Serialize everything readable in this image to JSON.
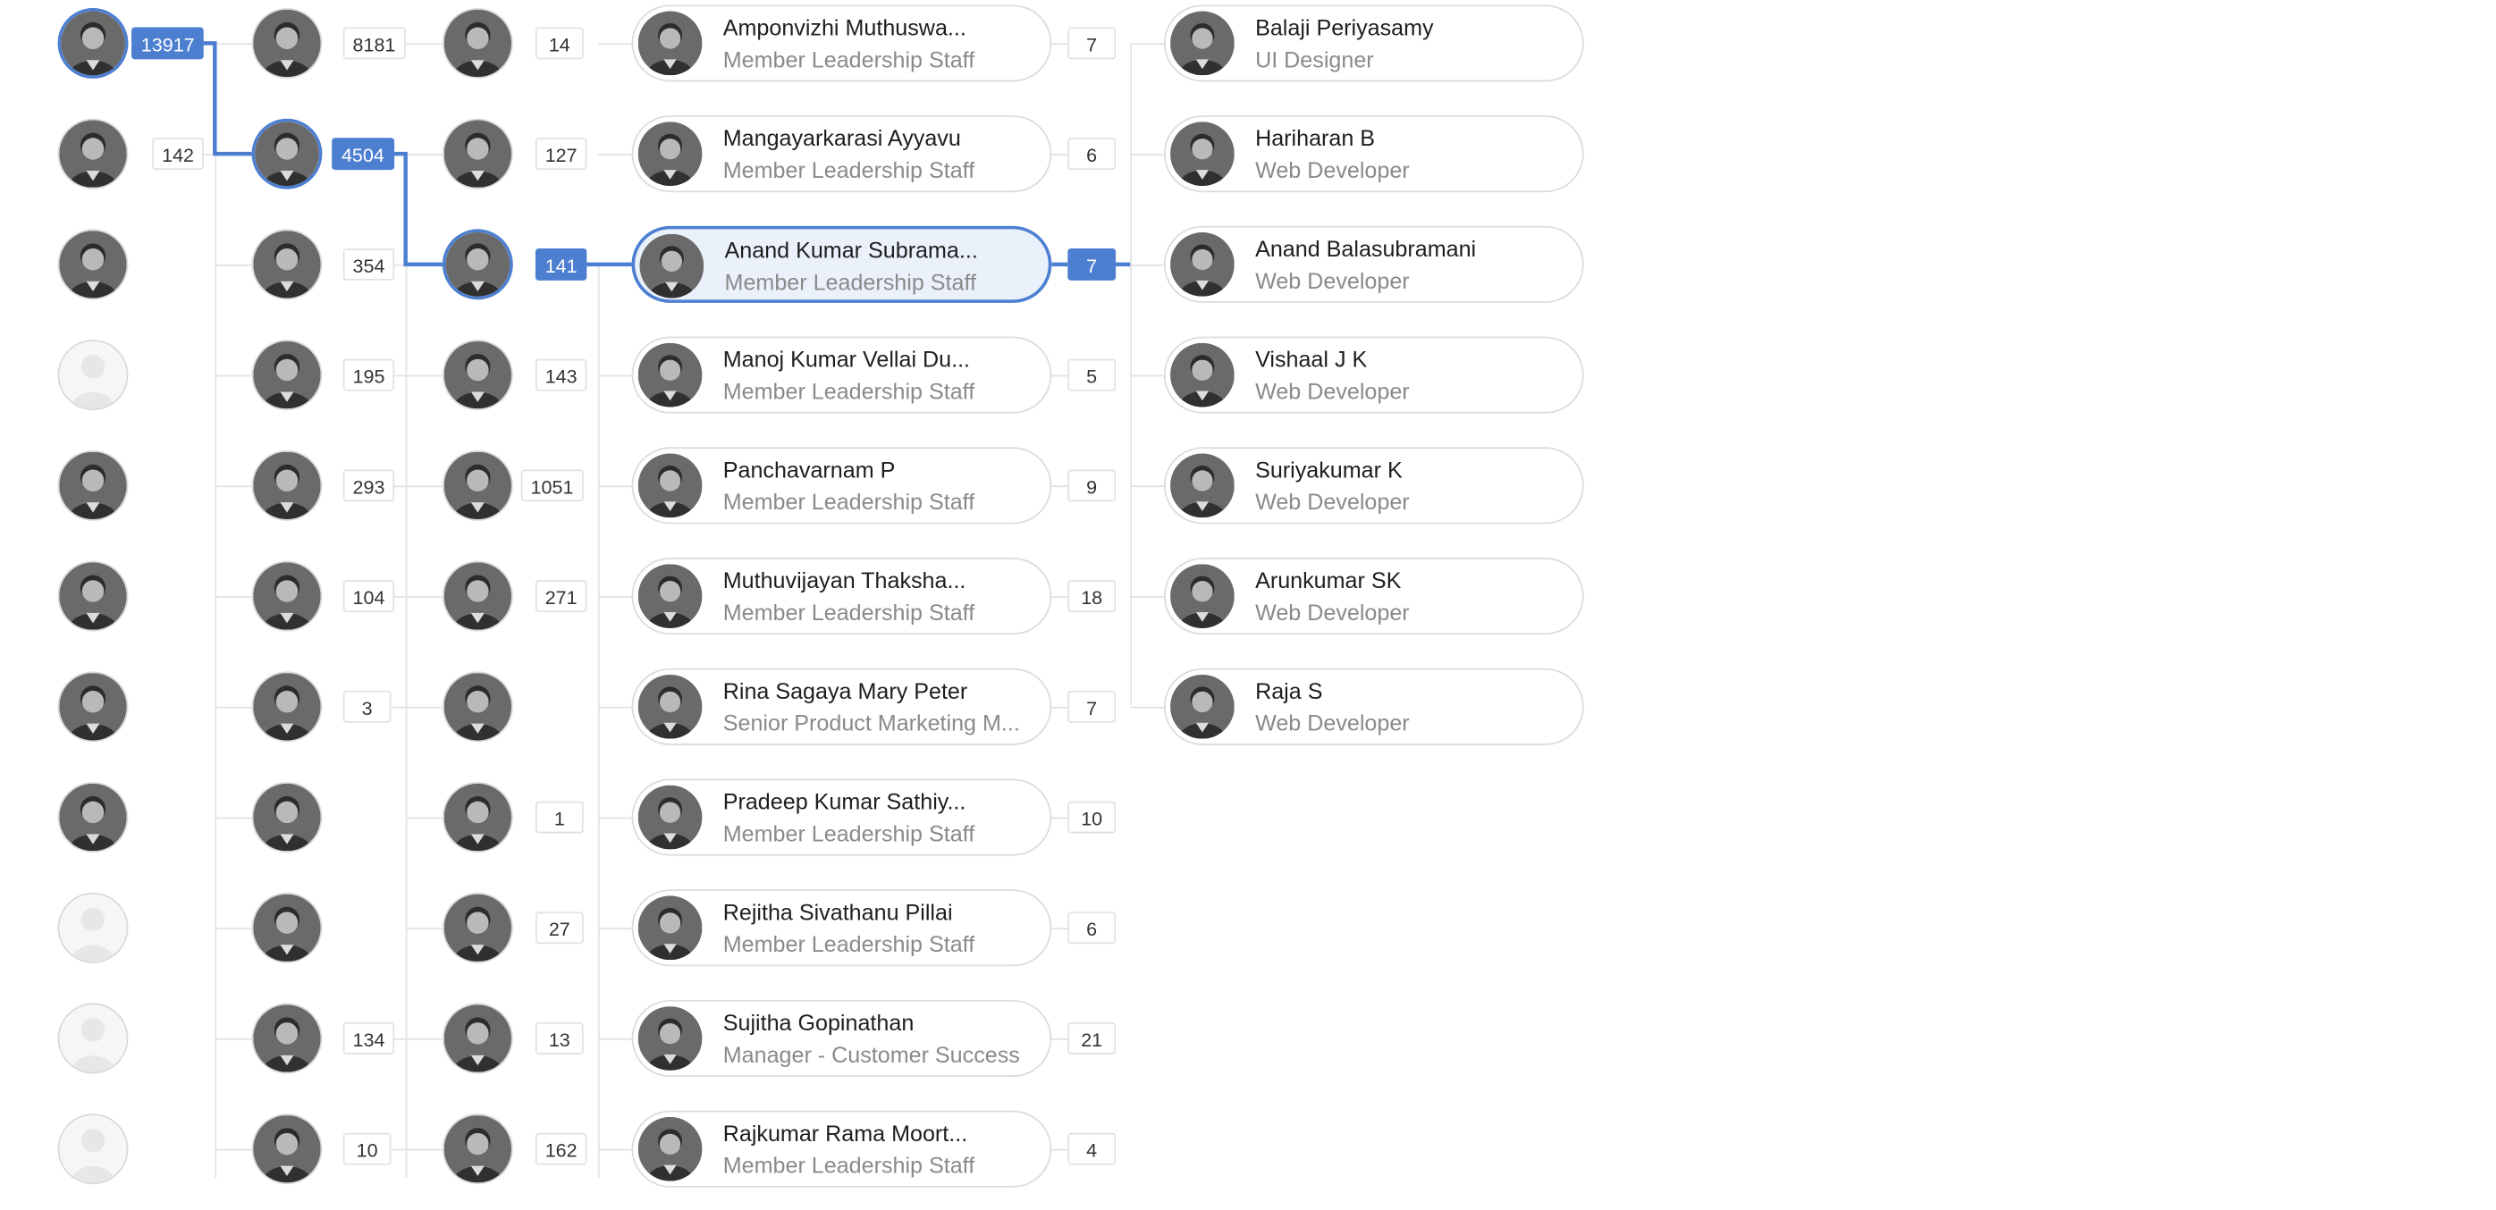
{
  "colors": {
    "accent": "#4d7fd1",
    "line": "#e2e2e2",
    "subtitle": "#8a8a8a"
  },
  "column1": [
    {
      "avatar": "person-photo",
      "count": "13917",
      "selected": true
    },
    {
      "avatar": "person-photo",
      "count": "142"
    },
    {
      "avatar": "person-photo"
    },
    {
      "avatar": "placeholder-person-icon"
    },
    {
      "avatar": "person-photo"
    },
    {
      "avatar": "person-photo"
    },
    {
      "avatar": "person-photo"
    },
    {
      "avatar": "person-photo"
    },
    {
      "avatar": "placeholder-person-icon"
    },
    {
      "avatar": "placeholder-person-icon"
    },
    {
      "avatar": "placeholder-person-icon"
    }
  ],
  "column2": [
    {
      "count": "8181"
    },
    {
      "count": "4504",
      "selected": true
    },
    {
      "count": "354"
    },
    {
      "count": "195"
    },
    {
      "count": "293"
    },
    {
      "count": "104"
    },
    {
      "count": "3"
    },
    {},
    {},
    {
      "count": "134"
    },
    {
      "count": "10"
    }
  ],
  "column3": [
    {
      "count": "14"
    },
    {
      "count": "127"
    },
    {
      "count": "141",
      "selected": true
    },
    {
      "count": "143"
    },
    {
      "count": "1051"
    },
    {
      "count": "271"
    },
    {},
    {
      "count": "1"
    },
    {
      "count": "27"
    },
    {
      "count": "13"
    },
    {
      "count": "162"
    }
  ],
  "column4": [
    {
      "name": "Amponvizhi Muthuswa...",
      "title": "Member Leadership Staff",
      "count": "7"
    },
    {
      "name": "Mangayarkarasi Ayyavu",
      "title": "Member Leadership Staff",
      "count": "6"
    },
    {
      "name": "Anand Kumar Subrama...",
      "title": "Member Leadership Staff",
      "count": "7",
      "selected": true
    },
    {
      "name": "Manoj Kumar Vellai Du...",
      "title": "Member Leadership Staff",
      "count": "5"
    },
    {
      "name": "Panchavarnam P",
      "title": "Member Leadership Staff",
      "count": "9"
    },
    {
      "name": "Muthuvijayan Thaksha...",
      "title": "Member Leadership Staff",
      "count": "18"
    },
    {
      "name": "Rina Sagaya Mary Peter",
      "title": "Senior Product Marketing M...",
      "count": "7"
    },
    {
      "name": "Pradeep Kumar Sathiy...",
      "title": "Member Leadership Staff",
      "count": "10"
    },
    {
      "name": "Rejitha Sivathanu Pillai",
      "title": "Member Leadership Staff",
      "count": "6"
    },
    {
      "name": "Sujitha Gopinathan",
      "title": "Manager - Customer Success",
      "count": "21"
    },
    {
      "name": "Rajkumar Rama Moort...",
      "title": "Member Leadership Staff",
      "count": "4"
    }
  ],
  "column5": [
    {
      "name": "Balaji Periyasamy",
      "title": "UI Designer"
    },
    {
      "name": "Hariharan B",
      "title": "Web Developer"
    },
    {
      "name": "Anand Balasubramani",
      "title": "Web Developer"
    },
    {
      "name": "Vishaal J K",
      "title": "Web Developer"
    },
    {
      "name": "Suriyakumar K",
      "title": "Web Developer"
    },
    {
      "name": "Arunkumar SK",
      "title": "Web Developer"
    },
    {
      "name": "Raja S",
      "title": "Web Developer"
    }
  ]
}
